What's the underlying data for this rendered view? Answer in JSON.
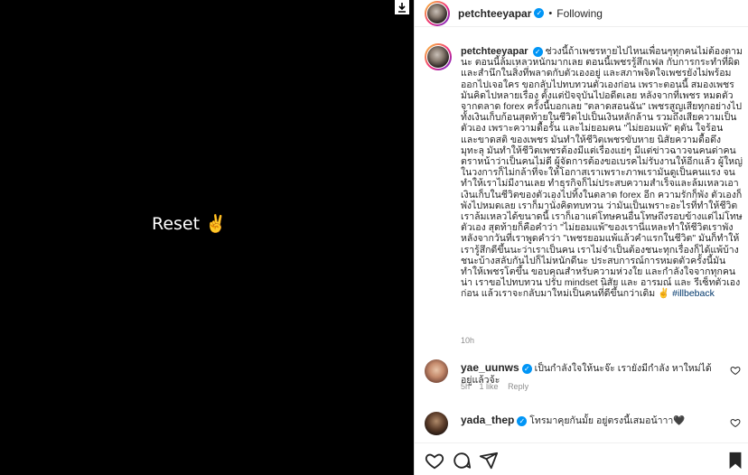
{
  "media": {
    "text": "Reset ✌️"
  },
  "post": {
    "username": "petchteeyapar",
    "follow_status": "Following",
    "caption_username": "petchteeyapar",
    "caption_text": "ช่วงนี้ถ้าเพชรหายไปไหนเพื่อนๆทุกคนไม่ต้องตามนะ ตอนนี้ล้มเหลวหนักมากเลย ตอนนี้เพชรรู้สึกเฟล กับการกระทำที่ผิด และสำนึกในสิ่งที่พลาดกับตัวเองอยู่ และสภาพจิตใจเพชรยังไม่พร้อมออกไปเจอใคร ขอกลับไปทบทวนตัวเองก่อน เพราะตอนนี้ สมองเพชรมันคิดไปหลายเรื่อง ตั้งแต่ปัจจุบันไปอดีตเลย หลังจากที่เพชร หมดตัวจากตลาด forex ครั้งนี้บอกเลย \"ตลาดสอนฉัน\" เพชรสูญเสียทุกอย่างไป ทั้งเงินเก็บก้อนสุดท้ายในชีวิตไปเป็นเงินหลักล้าน รวมถึงเสียความเป็นตัวเอง เพราะความดื้อรั้น และไม่ยอมคน \"ไม่ยอมแพ้\" ดุดัน ใจร้อน และขาดสติ ของเพชร มันทำให้ชีวิตเพชรขับหาย นิสัยความดื้อดึง มุทะลุ มันทำให้ชีวิตเพชรต้องมีแต่เรื่องแย่ๆ มีแต่ข่าวฉาวจนคนด่าคนตราหน้าว่าเป็นคนไม่ดี ผู้จัดการต้องขอเบรคไม่รับงานให้อีกแล้ว ผู้ใหญ่ในวงการก็ไม่กล้าที่จะให้โอกาสเราเพราะภาพเรามันดูเป็นคนแรง จนทำให้เราไม่มีงานเลย ทำธุรกิจก็ไม่ประสบความสำเร็จและล้มเหลวเอาเงินเก็บในชีวิตของตัวเองไปทิ้งในตลาด forex อีก ความรักก็พัง ตัวเองก็พังไปหมดเลย เราก็มานั่งคิดทบทวน ว่ามันเป็นเพราะอะไรที่ทำให้ชีวิตเราล้มเหลวได้ขนาดนี้ เราก็เอาแต่โทษคนอื่นโทษถึงรอบข้างแต่ไม่โทษตัวเอง สุดท้ายก็คือคำว่า \"ไม่ยอมแพ้\"ของเรานี่แหละทำให้ชีวิตเราพัง หลังจากวันที่เราพูดคำว่า \"เพชรยอมแพ้แล้วคำแรกในชีวิต\" มันก็ทำให้เรารู้สึกดีขึ้นนะว่าเราเป็นคน เราไม่จำเป็นต้องชนะทุกเรื่องก็ได้แพ้บ้างชนะบ้างสลับกันไปก็ไม่หนักดีนะ ประสบการณ์การหมดตัวครั้งนี้มันทำให้เพชรโตขึ้น ขอบคุณสำหรับความห่วงใย และกำลังใจจากทุกคนน่า เราขอไปทบทวน ปรับ mindset นิสัย และ อารมณ์ และ รีเซ็ทตัวเองก่อน แล้วเราจะกลับมาใหม่เป็นคนที่ดีขึ้นกว่าเดิม ✌️",
    "hashtag": "#illbeback",
    "time_ago": "10h"
  },
  "comments": [
    {
      "username": "yae_uunws",
      "text": "เป็นกำลังใจให้นะจ๊ะ เรายังมีกำลัง หาใหม่ได้อยู่แล้วจ้ะ",
      "time": "5h",
      "likes": "1 like",
      "reply": "Reply"
    },
    {
      "username": "yada_thep",
      "text": "โทรมาคุยกันมั้ย อยู่ตรงนี้เสมอน้าาา🖤"
    }
  ],
  "colors": {
    "verified": "#0095f6",
    "hashtag": "#00376b",
    "muted": "#8e8e8e"
  }
}
